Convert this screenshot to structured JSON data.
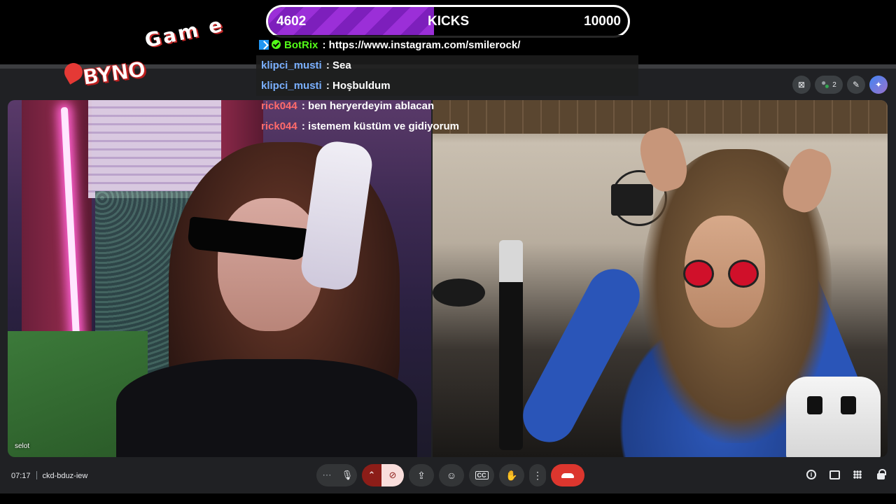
{
  "overlay": {
    "goal": {
      "current": "4602",
      "label": "KICKS",
      "target": "10000",
      "progress_fraction": 0.4602,
      "fill_color": "#9b2fd8"
    },
    "chat": [
      {
        "user": "BotRix",
        "message": ": https://www.instagram.com/smilerock/",
        "user_color": "#53fc18",
        "badges": [
          "bot-badge",
          "verified-badge"
        ]
      },
      {
        "user": "klipci_musti",
        "message": ": Sea",
        "user_color": "#7ab0ff"
      },
      {
        "user": "klipci_musti",
        "message": ": Hoşbuldum",
        "user_color": "#7ab0ff"
      },
      {
        "user": "rick044",
        "message": ": ben heryerdeyim ablacan",
        "user_color": "#ff6b6b"
      },
      {
        "user": "rick044",
        "message": ": istemem küstüm ve gidiyorum",
        "user_color": "#ff6b6b"
      }
    ]
  },
  "meet": {
    "top_icons": {
      "participants_count": "2"
    },
    "tiles": [
      {
        "name": "selot"
      },
      {
        "name": ""
      }
    ],
    "bottom_bar": {
      "time": "07:17",
      "meeting_code": "ckd-bduz-iew",
      "controls": {
        "more_options": "⋯",
        "mic_icon": "🎤",
        "camera_options": "⌃",
        "camera_off_icon": "⊘",
        "present_icon": "⇪",
        "reactions_icon": "☺",
        "captions_icon": "CC",
        "raise_hand_icon": "✋",
        "more_vert": "⋮"
      }
    },
    "colors": {
      "hangup": "#dc362e",
      "camera_off_bg": "#f9dedc",
      "camera_off_icon": "#8c1d18",
      "toolbar_button": "#333537"
    }
  }
}
